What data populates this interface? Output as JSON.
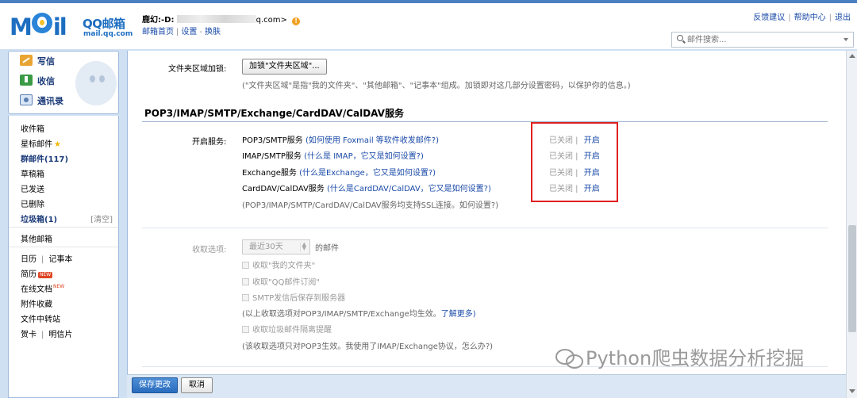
{
  "header": {
    "logo_main": "M",
    "logo_rest": "il",
    "logo_qq": "QQ邮箱",
    "logo_url": "mail.qq.com",
    "user_name": "鹿幻:-D:",
    "user_email_suffix": "q.com>",
    "links": {
      "home": "邮箱首页",
      "settings": "设置",
      "skin": "换肤"
    },
    "top_links": {
      "feedback": "反馈建议",
      "help": "帮助中心",
      "logout": "退出"
    },
    "search_placeholder": "邮件搜索..."
  },
  "sidebar": {
    "write": "写信",
    "receive": "收信",
    "contacts": "通讯录",
    "inbox": "收件箱",
    "starred": "星标邮件",
    "group": "群邮件(117)",
    "drafts": "草稿箱",
    "sent": "已发送",
    "deleted": "已删除",
    "spam": "垃圾箱(1)",
    "spam_clear": "[清空]",
    "other": "其他邮箱",
    "calendar": "日历",
    "notebook": "记事本",
    "resume": "简历",
    "new_badge": "NEW",
    "online_doc": "在线文档",
    "attachments": "附件收藏",
    "transfer": "文件中转站",
    "greeting": "贺卡",
    "postcard": "明信片"
  },
  "content": {
    "folder_lock_label": "文件夹区域加锁:",
    "folder_lock_button": "加锁\"文件夹区域\"...",
    "folder_lock_note": "(\"文件夹区域\"是指\"我的文件夹\"、\"其他邮箱\"、\"记事本\"组成。加锁即对这几部分设置密码，以保护你的信息。)",
    "section_title": "POP3/IMAP/SMTP/Exchange/CardDAV/CalDAV服务",
    "enable_label": "开启服务:",
    "services": [
      {
        "name": "POP3/SMTP服务",
        "help": "(如何使用 Foxmail 等软件收发邮件?)",
        "state": "已关闭",
        "action": "开启"
      },
      {
        "name": "IMAP/SMTP服务",
        "help": "(什么是 IMAP，它又是如何设置?)",
        "state": "已关闭",
        "action": "开启"
      },
      {
        "name": "Exchange服务",
        "help": "(什么是Exchange，它又是如何设置?)",
        "state": "已关闭",
        "action": "开启"
      },
      {
        "name": "CardDAV/CalDAV服务",
        "help": "(什么是CardDAV/CalDAV，它又是如何设置?)",
        "state": "已关闭",
        "action": "开启"
      }
    ],
    "ssl_note": "(POP3/IMAP/SMTP/CardDAV/CalDAV服务均支持SSL连接。如何设置?)",
    "receive_label": "收取选项:",
    "receive_select": "最近30天",
    "receive_suffix": "的邮件",
    "checkbox_myfolder": "收取\"我的文件夹\"",
    "checkbox_subscription": "收取\"QQ邮件订阅\"",
    "checkbox_smtp_save": "SMTP发信后保存到服务器",
    "receive_note": "(以上收取选项对POP3/IMAP/SMTP/Exchange均生效。",
    "learn_more": "了解更多)",
    "checkbox_spam": "收取垃圾邮件隔离提醒",
    "pop3_note": "(该收取选项只对POP3生效。我使用了IMAP/Exchange协议，怎么办?)"
  },
  "footer": {
    "save": "保存更改",
    "cancel": "取消"
  },
  "watermark": "Python爬虫数据分析挖掘"
}
